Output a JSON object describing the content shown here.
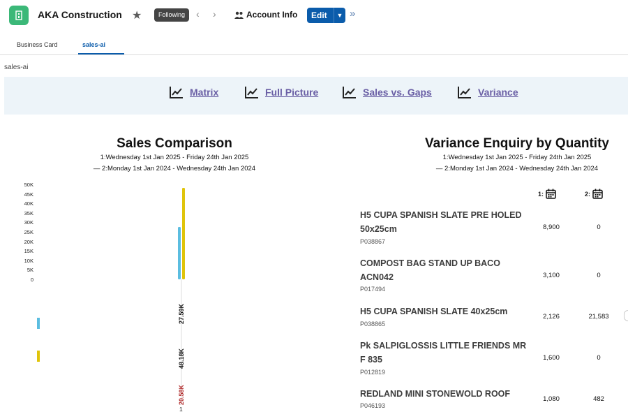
{
  "header": {
    "title": "AKA Construction",
    "following_label": "Following",
    "account_label": "Account Info",
    "edit_label": "Edit"
  },
  "tabs": [
    {
      "label": "Business Card"
    },
    {
      "label": "sales-ai"
    }
  ],
  "breadcrumb": "sales-ai",
  "links": [
    {
      "label": "Matrix"
    },
    {
      "label": "Full Picture"
    },
    {
      "label": "Sales vs. Gaps"
    },
    {
      "label": "Variance"
    }
  ],
  "sales_comparison": {
    "title": "Sales Comparison",
    "period1": "1:Wednesday 1st Jan 2025 - Friday 24th Jan 2025",
    "period2": "2:Monday 1st Jan 2024 - Wednesday 24th Jan 2024"
  },
  "chart_data": {
    "type": "bar",
    "categories": [
      "1"
    ],
    "yticks": [
      "50K",
      "45K",
      "40K",
      "35K",
      "30K",
      "25K",
      "20K",
      "15K",
      "10K",
      "5K",
      "0"
    ],
    "ylim": [
      0,
      50000
    ],
    "series": [
      {
        "values": [
          27590
        ],
        "color": "#5bbde0"
      },
      {
        "values": [
          48180
        ],
        "color": "#e0c40a"
      }
    ],
    "value_labels": [
      "27.59K",
      "48.18K",
      "20.58K"
    ],
    "value_label_colors": [
      "#111111",
      "#111111",
      "#b02a2a"
    ]
  },
  "variance": {
    "title": "Variance Enquiry by Quantity",
    "period1": "1:Wednesday 1st Jan 2025 - Friday 24th Jan 2025",
    "period2": "2:Monday 1st Jan 2024 - Wednesday 24th Jan 2024",
    "col1": "1:",
    "col2": "2:",
    "items": [
      {
        "name": "H5 CUPA SPANISH SLATE PRE HOLED 50x25cm",
        "code": "P038867",
        "q1": "8,900",
        "q2": "0"
      },
      {
        "name": "COMPOST BAG STAND UP BACO ACN042",
        "code": "P017494",
        "q1": "3,100",
        "q2": "0"
      },
      {
        "name": "H5 CUPA SPANISH SLATE 40x25cm",
        "code": "P038865",
        "q1": "2,126",
        "q2": "21,583"
      },
      {
        "name": "Pk SALPIGLOSSIS LITTLE FRIENDS MR F 835",
        "code": "P012819",
        "q1": "1,600",
        "q2": "0"
      },
      {
        "name": "REDLAND MINI STONEWOLD ROOF",
        "code": "P046193",
        "q1": "1,080",
        "q2": "482"
      }
    ]
  },
  "colors": {
    "brand": "#3bb878",
    "accent": "#0b5cab",
    "link": "#6a5fa5"
  }
}
